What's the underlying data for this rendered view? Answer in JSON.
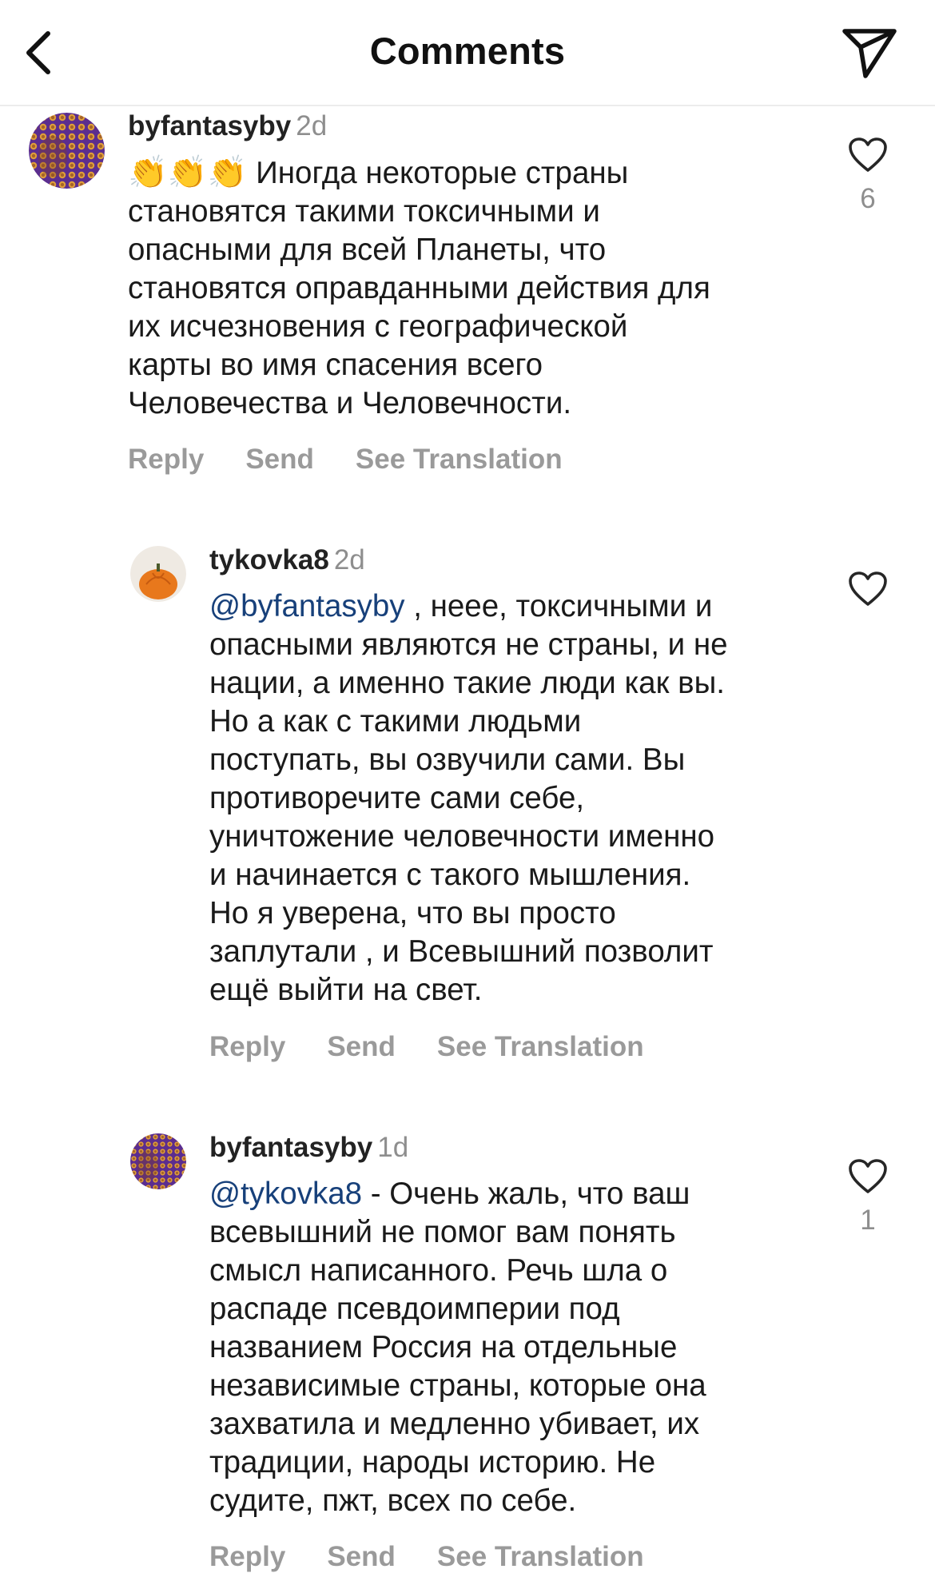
{
  "header": {
    "title": "Comments",
    "back_icon": "chevron-left-icon",
    "send_icon": "paper-plane-icon"
  },
  "comments": [
    {
      "username": "byfantasyby",
      "time": "2d",
      "emoji": "👏👏👏",
      "text": "Иногда некоторые страны\nстановятся такими токсичными и\nопасными для всей Планеты, что\nстановятся оправданными действия для\nих исчезновения с географической\nкарты во имя спасения всего\nЧеловечества и Человечности.",
      "likes": "6",
      "actions": {
        "reply": "Reply",
        "send": "Send",
        "translate": "See Translation"
      }
    },
    {
      "username": "tykovka8",
      "time": "2d",
      "mention": "@byfantasyby",
      "text": " , неее, токсичными и\nопасными являются не страны, и не\nнации, а именно такие люди как вы.\nНо а как с такими людьми\nпоступать, вы озвучили сами. Вы\nпротиворечите сами себе,\nуничтожение  человечности именно\nи начинается с такого мышления.\nНо я уверена, что вы просто\nзаплутали , и Всевышний позволит\nещё выйти на свет.",
      "likes": "",
      "actions": {
        "reply": "Reply",
        "send": "Send",
        "translate": "See Translation"
      }
    },
    {
      "username": "byfantasyby",
      "time": "1d",
      "mention": "@tykovka8",
      "text": " - Очень жаль, что ваш\nвсевышний не помог вам понять\nсмысл написанного. Речь шла о\nраспаде псевдоимперии под\nназванием Россия на отдельные\nнезависимые страны, которые она\nзахватила и медленно убивает, их\nтрадиции, народы  историю. Не\nсудите, пжт, всех по себе.",
      "likes": "1",
      "actions": {
        "reply": "Reply",
        "send": "Send",
        "translate": "See Translation"
      }
    }
  ],
  "colors": {
    "mention": "#17407a",
    "muted": "#8e8e8e",
    "action": "#9a9a9a"
  }
}
